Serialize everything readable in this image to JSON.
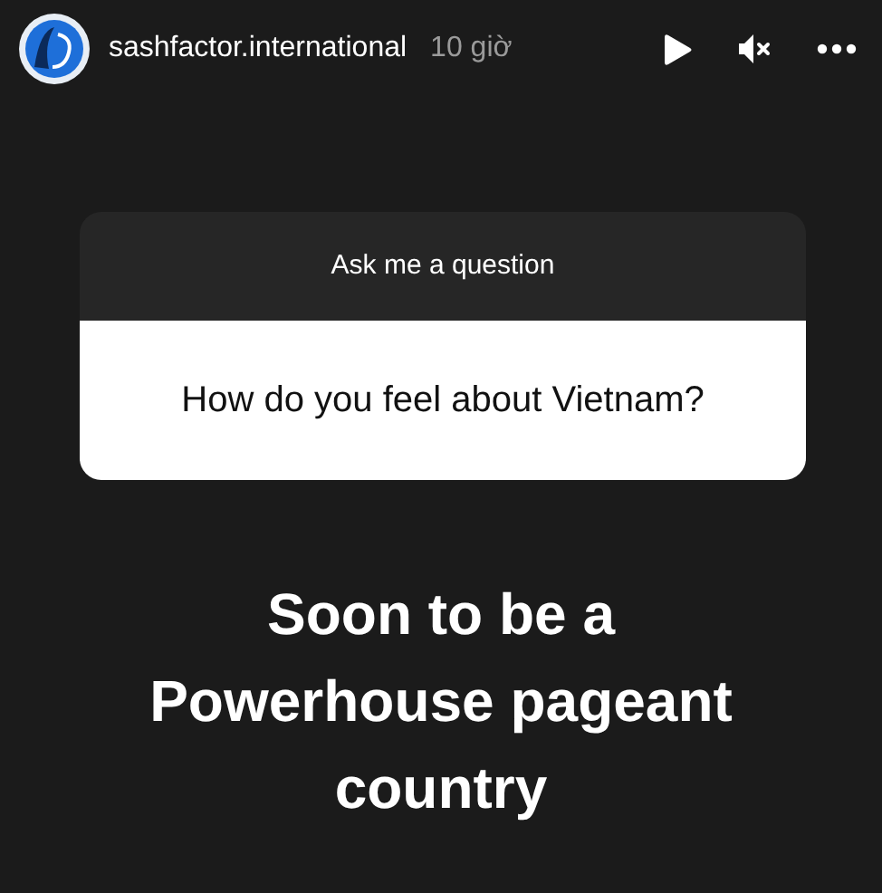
{
  "header": {
    "username": "sashfactor.international",
    "time": "10 giờ"
  },
  "question_sticker": {
    "title": "Ask me a question",
    "question": "How do you feel about Vietnam?"
  },
  "answer_text": "Soon to be a\nPowerhouse pageant\ncountry"
}
